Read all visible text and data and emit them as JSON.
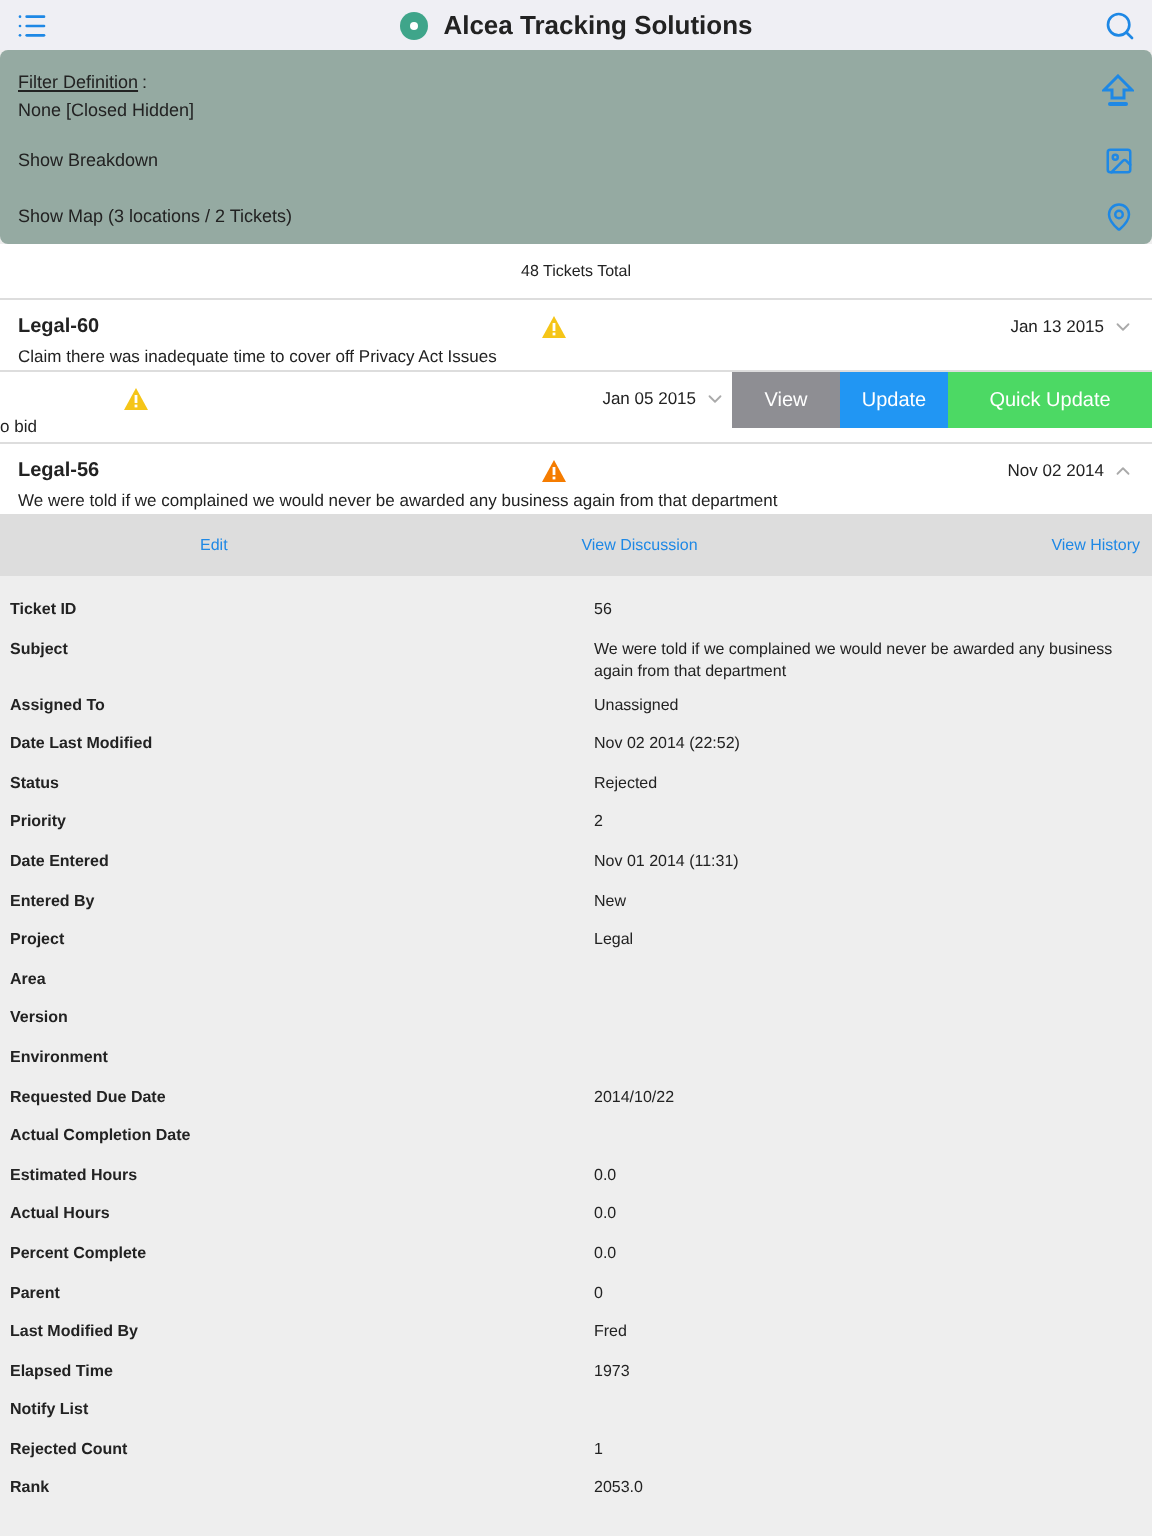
{
  "header": {
    "title": "Alcea Tracking Solutions"
  },
  "filter_panel": {
    "filter_label": "Filter Definition",
    "filter_separator": ":",
    "filter_value": "None [Closed Hidden]",
    "breakdown": "Show Breakdown",
    "map": "Show Map (3 locations / 2 Tickets)"
  },
  "total": "48 Tickets Total",
  "tickets": [
    {
      "kind": "normal",
      "id": "Legal-60",
      "description": "Claim there was inadequate time to cover off Privacy Act Issues",
      "date": "Jan 13 2015",
      "color": "#f5c518",
      "expanded": false
    },
    {
      "kind": "swiped",
      "description": "o bid",
      "date": "Jan 05 2015",
      "color": "#f5c518",
      "expanded": false,
      "actions": [
        "View",
        "Update",
        "Quick Update"
      ]
    },
    {
      "kind": "normal",
      "id": "Legal-56",
      "description": "We were told if we complained we would never be awarded any business again from that department",
      "date": "Nov 02 2014",
      "color": "#f57c00",
      "expanded": true
    }
  ],
  "detail_actions": [
    "Edit",
    "View Discussion",
    "View History"
  ],
  "details": [
    {
      "label": "Ticket ID",
      "value": "56"
    },
    {
      "label": "Subject",
      "value": "We were told if we complained we would never be awarded any business again from that department"
    },
    {
      "label": "Assigned To",
      "value": "Unassigned"
    },
    {
      "label": "Date Last Modified",
      "value": "Nov 02 2014 (22:52)"
    },
    {
      "label": "Status",
      "value": "Rejected"
    },
    {
      "label": "Priority",
      "value": "2"
    },
    {
      "label": "Date Entered",
      "value": "Nov 01 2014 (11:31)"
    },
    {
      "label": "Entered By",
      "value": "New"
    },
    {
      "label": "Project",
      "value": "Legal"
    },
    {
      "label": "Area"
    },
    {
      "label": "Version"
    },
    {
      "label": "Environment"
    },
    {
      "label": "Requested Due Date",
      "value": "2014/10/22"
    },
    {
      "label": "Actual Completion Date"
    },
    {
      "label": "Estimated Hours",
      "value": "0.0"
    },
    {
      "label": "Actual Hours",
      "value": "0.0"
    },
    {
      "label": "Percent Complete",
      "value": "0.0"
    },
    {
      "label": "Parent",
      "value": "0"
    },
    {
      "label": "Last Modified By",
      "value": "Fred"
    },
    {
      "label": "Elapsed Time",
      "value": "1973"
    },
    {
      "label": "Notify List"
    },
    {
      "label": "Rejected Count",
      "value": "1"
    },
    {
      "label": "Rank",
      "value": "2053.0"
    }
  ]
}
